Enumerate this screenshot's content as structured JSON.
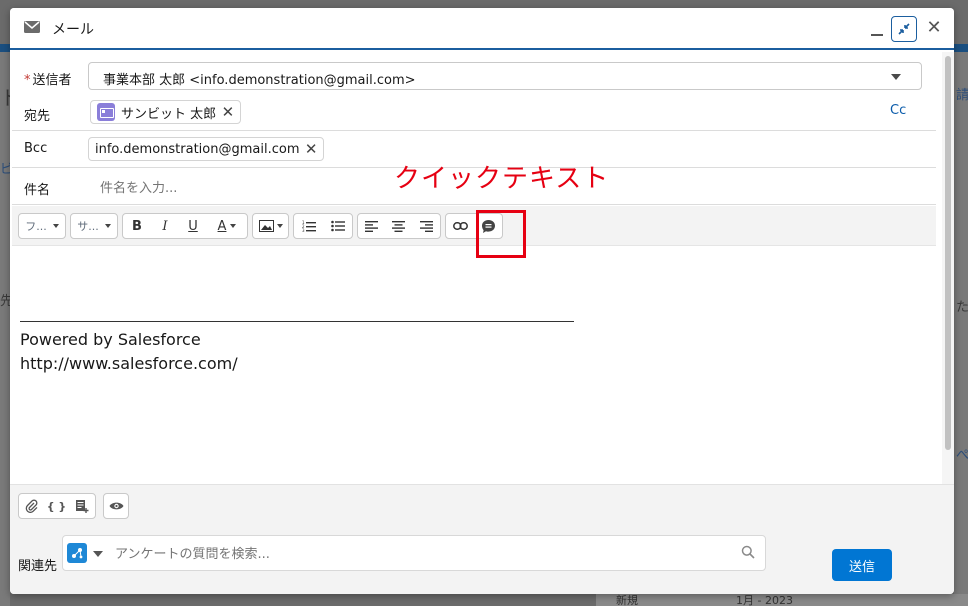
{
  "background": {
    "fragments": [
      "ト",
      "請",
      "先",
      "ビ",
      "た",
      "ぺ",
      "新規",
      "1月 - 2023"
    ]
  },
  "modal": {
    "title": "メール",
    "title_icon": "mail-icon",
    "controls": {
      "minimize_icon": "minimize-icon",
      "restore_icon": "collapse-arrows-icon",
      "close_icon": "close-icon",
      "close_glyph": "✕"
    }
  },
  "form": {
    "sender": {
      "label": "送信者",
      "required_mark": "*",
      "value": "事業本部 太郎 <info.demonstration@gmail.com>"
    },
    "to": {
      "label": "宛先",
      "recipients": [
        {
          "name": "サンビット 太郎",
          "icon": "contact-icon"
        }
      ],
      "cc_label": "Cc"
    },
    "bcc": {
      "label": "Bcc",
      "recipients": [
        {
          "name": "info.demonstration@gmail.com"
        }
      ]
    },
    "subject": {
      "label": "件名",
      "placeholder": "件名を入力...",
      "value": ""
    }
  },
  "toolbar": {
    "font_family": "フ...",
    "font_size": "サ...",
    "bold": "B",
    "italic": "I",
    "underline": "U",
    "text_color": "A",
    "icons": {
      "image": "image-icon",
      "numbered_list": "numbered-list-icon",
      "bulleted_list": "bulleted-list-icon",
      "align_left": "align-left-icon",
      "align_center": "align-center-icon",
      "align_right": "align-right-icon",
      "link": "link-icon",
      "quick_text": "quick-text-icon"
    }
  },
  "editor": {
    "signature_line1": "Powered by Salesforce",
    "signature_line2": "http://www.salesforce.com/"
  },
  "footer": {
    "icons": [
      "paperclip-icon",
      "merge-field-icon",
      "template-icon",
      "preview-icon"
    ],
    "merge_field_glyph": "{ }",
    "related_label": "関連先",
    "related_placeholder": "アンケートの質問を検索...",
    "send_label": "送信"
  },
  "annotation": {
    "label": "クイックテキスト",
    "color": "#e60012"
  },
  "colors": {
    "brand_blue": "#0176d3",
    "header_rule": "#1b5e9f",
    "required": "#c23934",
    "link": "#0b5cab",
    "contact_icon": "#8a7ed9"
  }
}
